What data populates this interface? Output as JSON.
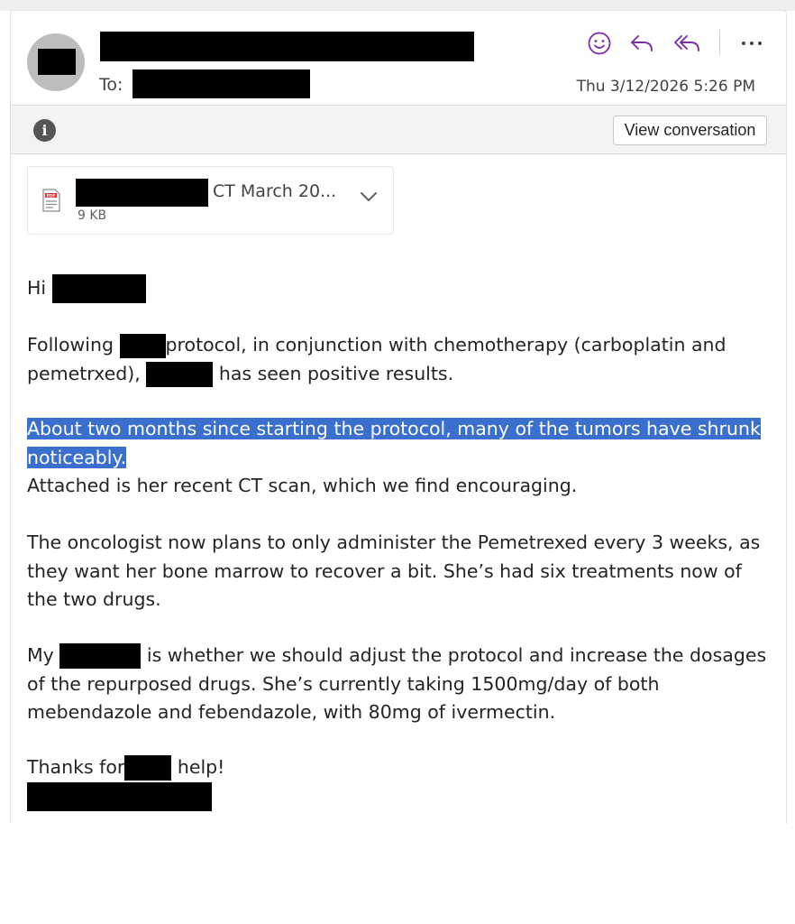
{
  "header": {
    "to_label": "To:",
    "date": "Thu 3/12/2026 5:26 PM",
    "actions": [
      {
        "name": "react-icon"
      },
      {
        "name": "reply-icon"
      },
      {
        "name": "reply-all-icon"
      },
      {
        "name": "more-options-icon"
      }
    ]
  },
  "info_bar": {
    "info_icon": "i",
    "view_conversation": "View conversation"
  },
  "attachment": {
    "name_suffix": "CT March 20...",
    "size": "9 KB",
    "type_icon": "pdf-icon"
  },
  "message": {
    "greeting_prefix": "Hi",
    "p1_a": "Following",
    "p1_b": "protocol, in conjunction with chemotherapy (carboplatin and pemetrxed),",
    "p1_c": "has seen positive results.",
    "p2_highlighted": "About two months since starting the protocol, many of the tumors have shrunk noticeably.",
    "p2_rest": "Attached is her recent CT scan, which we find encouraging.",
    "p3": "The oncologist now plans to only administer the Pemetrexed every 3 weeks, as they want her bone marrow to recover a bit. She’s had six treatments now of the two drugs.",
    "p4_a": "My",
    "p4_b": "is whether we should adjust the protocol and increase the dosages of the repurposed drugs. She’s currently taking 1500mg/day of both mebendazole and febendazole, with 80mg of ivermectin.",
    "p5_a": "Thanks for",
    "p5_b": "help!"
  },
  "colors": {
    "highlight": "#3a6fce",
    "accent_purple": "#7b2fa6",
    "redaction": "#000000"
  }
}
